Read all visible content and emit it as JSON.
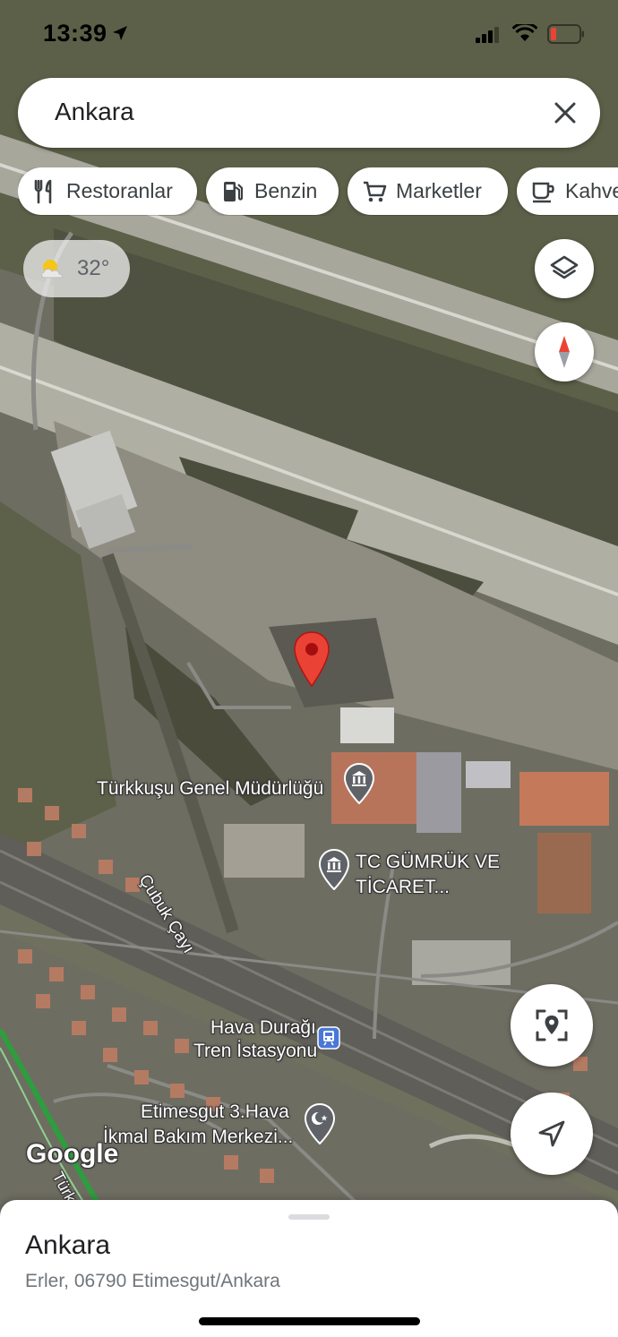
{
  "status_bar": {
    "time": "13:39"
  },
  "search": {
    "query": "Ankara",
    "clear_icon": "close-icon"
  },
  "chips": [
    {
      "label": "Restoranlar",
      "icon": "fork-knife-icon"
    },
    {
      "label": "Benzin",
      "icon": "gas-station-icon"
    },
    {
      "label": "Marketler",
      "icon": "shopping-cart-icon"
    },
    {
      "label": "Kahve",
      "icon": "coffee-cup-icon"
    }
  ],
  "weather": {
    "temperature": "32°",
    "icon": "partly-cloudy-icon"
  },
  "map_labels": {
    "turkkusu": "Türkkuşu Genel Müdürlüğü",
    "gumruk_line1": "TC GÜMRÜK VE",
    "gumruk_line2": "TİCARET...",
    "river": "Çubuk Çayı",
    "station_line1": "Hava Durağı",
    "station_line2": "Tren İstasyonu",
    "etimesgut_line1": "Etimesgut 3.Hava",
    "etimesgut_line2": "İkmal Bakım Merkezi...",
    "road": "Türk",
    "google_logo": "Google"
  },
  "colors": {
    "accent_red": "#ea4335",
    "poi_gray": "#5f6368",
    "transit_blue": "#4a78d8"
  },
  "bottom_sheet": {
    "title": "Ankara",
    "address": "Erler, 06790 Etimesgut/Ankara"
  }
}
